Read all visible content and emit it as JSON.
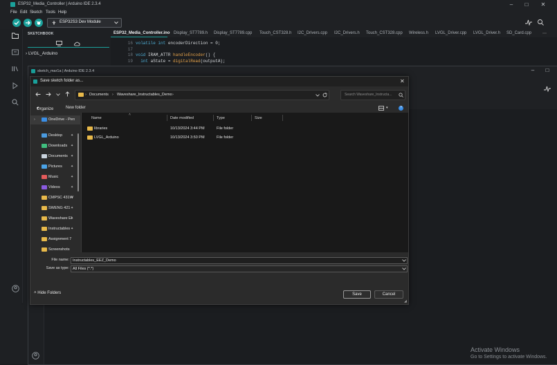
{
  "ide": {
    "title": "ESP32_Media_Controller | Arduino IDE 2.3.4",
    "menu": [
      "File",
      "Edit",
      "Sketch",
      "Tools",
      "Help"
    ],
    "board": "ESP32S3 Dev Module",
    "sidebar_title": "SKETCHBOOK",
    "sketch_item": "LVGL_Arduino",
    "tabs": [
      "ESP32_Media_Controller.ino",
      "Display_ST7789.h",
      "Display_ST7789.cpp",
      "Touch_CST328.h",
      "I2C_Drivers.cpp",
      "I2C_Drivers.h",
      "Touch_CST328.cpp",
      "Wireless.h",
      "LVGL_Driver.cpp",
      "LVGL_Driver.h",
      "SD_Card.cpp"
    ],
    "code": [
      {
        "ln": "16",
        "parts": [
          {
            "c": "kw",
            "t": "volatile "
          },
          {
            "c": "ty",
            "t": "int "
          },
          {
            "c": "tx",
            "t": "encoderDirection = 0;"
          }
        ]
      },
      {
        "ln": "17",
        "parts": []
      },
      {
        "ln": "18",
        "parts": [
          {
            "c": "ty",
            "t": "void "
          },
          {
            "c": "tx",
            "t": "IRAM_ATTR "
          },
          {
            "c": "fn",
            "t": "handleEncoder"
          },
          {
            "c": "tx",
            "t": "() {"
          }
        ]
      },
      {
        "ln": "19",
        "parts": [
          {
            "c": "tx",
            "t": "  "
          },
          {
            "c": "ty",
            "t": "int "
          },
          {
            "c": "tx",
            "t": "aState = "
          },
          {
            "c": "fn",
            "t": "digitalRead"
          },
          {
            "c": "tx",
            "t": "(outputA);"
          }
        ]
      }
    ]
  },
  "sketch_window": {
    "title": "sketch_mar1a | Arduino IDE 2.3.4"
  },
  "dialog": {
    "title": "Save sketch folder as...",
    "breadcrumb": [
      "Documents",
      "Waveshare_Instructables_Demo"
    ],
    "search_placeholder": "Search Waveshare_Instructa...",
    "organize": "Organize",
    "new_folder": "New folder",
    "nav": [
      {
        "label": "OneDrive - Perso",
        "color": "#3a8ee6",
        "pinned": false
      },
      {
        "label": "Desktop",
        "color": "#4a9be0",
        "pinned": true
      },
      {
        "label": "Downloads",
        "color": "#3fbf7f",
        "pinned": true
      },
      {
        "label": "Documents",
        "color": "#c9d3dd",
        "pinned": true
      },
      {
        "label": "Pictures",
        "color": "#4aa3e8",
        "pinned": true
      },
      {
        "label": "Music",
        "color": "#e55b5b",
        "pinned": true
      },
      {
        "label": "Videos",
        "color": "#8a5be0",
        "pinned": true
      },
      {
        "label": "CMPSC 431W",
        "color": "#e8b94a",
        "pinned": true
      },
      {
        "label": "SWENG 421",
        "color": "#e8b94a",
        "pinned": true
      },
      {
        "label": "Waveshare El",
        "color": "#e8b94a",
        "pinned": true
      },
      {
        "label": "Instructables",
        "color": "#e8b94a",
        "pinned": true
      },
      {
        "label": "Assignment 7",
        "color": "#e8b94a",
        "pinned": false
      },
      {
        "label": "Screenshots",
        "color": "#e8b94a",
        "pinned": false
      }
    ],
    "columns": [
      "Name",
      "Date modified",
      "Type",
      "Size"
    ],
    "files": [
      {
        "name": "libraries",
        "date": "10/13/2024 3:44 PM",
        "type": "File folder"
      },
      {
        "name": "LVGL_Arduino",
        "date": "10/13/2024 3:50 PM",
        "type": "File folder"
      }
    ],
    "filename_label": "File name:",
    "filename_value": "Instructables_EEZ_Demo",
    "savetype_label": "Save as type:",
    "savetype_value": "All Files (*.*)",
    "hide_folders": "Hide Folders",
    "save": "Save",
    "cancel": "Cancel"
  },
  "watermark": {
    "line1": "Activate Windows",
    "line2": "Go to Settings to activate Windows."
  }
}
